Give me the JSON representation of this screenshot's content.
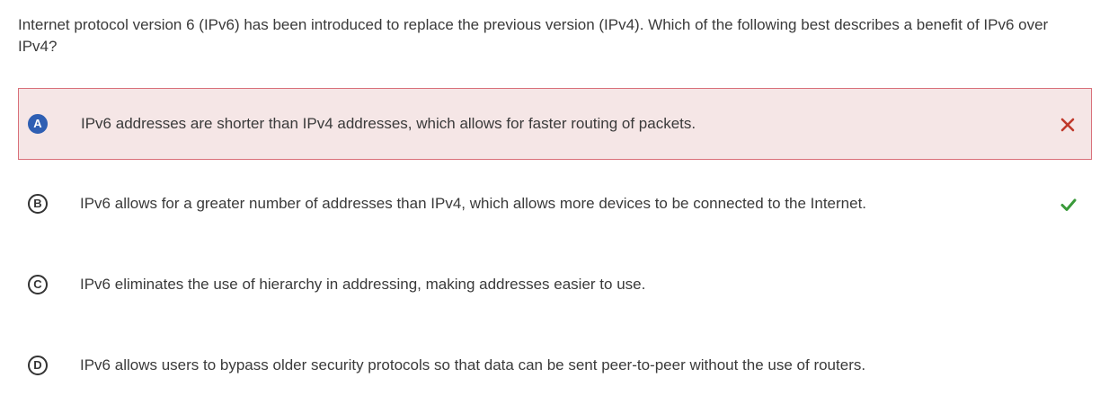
{
  "question": {
    "text": "Internet protocol version 6 (IPv6) has been introduced to replace the previous version (IPv4). Which of the following best describes a benefit of IPv6 over IPv4?"
  },
  "options": [
    {
      "letter": "A",
      "text": "IPv6 addresses are shorter than IPv4 addresses, which allows for faster routing of packets.",
      "state": "selected-incorrect",
      "mark": "x-icon"
    },
    {
      "letter": "B",
      "text": "IPv6 allows for a greater number of addresses than IPv4, which allows more devices to be connected to the Internet.",
      "state": "correct",
      "mark": "check-icon"
    },
    {
      "letter": "C",
      "text": "IPv6 eliminates the use of hierarchy in addressing, making addresses easier to use.",
      "state": "none"
    },
    {
      "letter": "D",
      "text": "IPv6 allows users to bypass older security protocols so that data can be sent peer-to-peer without the use of routers.",
      "state": "none"
    }
  ],
  "colors": {
    "incorrect_bg": "#f5e6e6",
    "incorrect_border": "#d9707a",
    "incorrect_mark": "#c0392b",
    "correct_mark": "#3a9a3a",
    "selected_letter_bg": "#2f5fb3"
  }
}
